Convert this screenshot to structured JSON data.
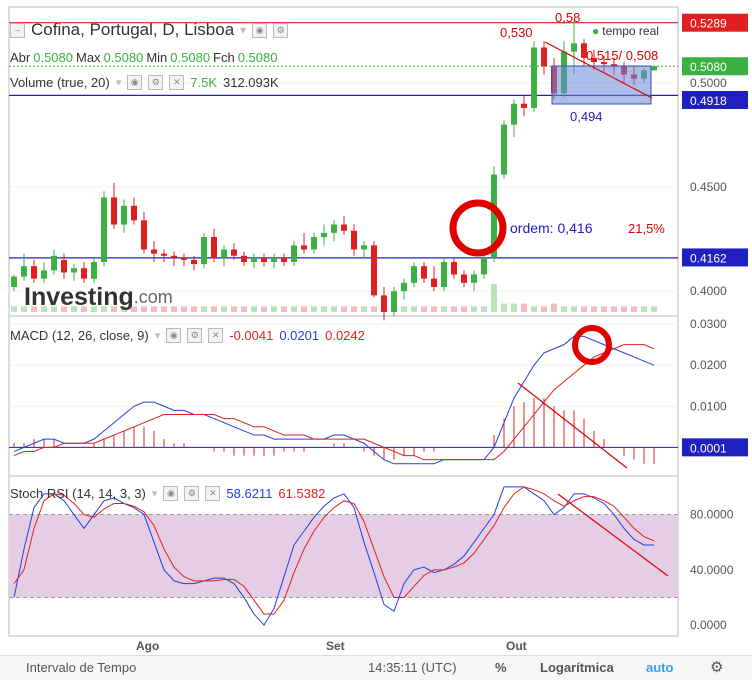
{
  "header": {
    "title": "Cofina, Portugal, D, Lisboa",
    "live_label": "tempo real",
    "ohlc": {
      "open_label": "Abr",
      "open": "0.5080",
      "high_label": "Max",
      "high": "0.5080",
      "low_label": "Min",
      "low": "0.5080",
      "close_label": "Fch",
      "close": "0.5080"
    },
    "volume": {
      "label": "Volume (true, 20)",
      "value1": "7.5K",
      "value2": "312.093K"
    }
  },
  "macd_header": {
    "label": "MACD (12, 26, close, 9)",
    "v1": "-0.0041",
    "v2": "0.0201",
    "v3": "0.0242"
  },
  "stoch_header": {
    "label": "Stoch RSI (14, 14, 3, 3)",
    "v1": "58.6211",
    "v2": "61.5382"
  },
  "logo": {
    "brand": "Investing",
    "suffix": ".com"
  },
  "bottom": {
    "interval": "Intervalo de Tempo",
    "time": "14:35:11 (UTC)",
    "percent": "%",
    "log": "Logarítmica",
    "auto": "auto"
  },
  "colors": {
    "up": "#3cb043",
    "down": "#e02020",
    "macd": "#2040e0",
    "signal": "#e02020",
    "stoch_band": "#e6cde6",
    "annot_blue": "#2020c0",
    "annot_red": "#e00000"
  },
  "annotations": {
    "hi1": "0,530",
    "hi2": "0,58",
    "pair": "0,515/ 0,508",
    "mid": "0,494",
    "ordem": "ordem: 0,416",
    "pct": "21,5%"
  },
  "chart_data": [
    {
      "type": "candlestick",
      "title": "Cofina, Portugal, D, Lisboa",
      "x_ticks": [
        "Ago",
        "Set",
        "Out"
      ],
      "y_ticks": [
        "0.4000",
        "0.4500",
        "0.5000"
      ],
      "ylim": [
        0.39,
        0.535
      ],
      "price_labels": [
        {
          "value": 0.5289,
          "label": "0.5289",
          "color": "#e02020"
        },
        {
          "value": 0.508,
          "label": "0.5080",
          "color": "#3cb043"
        },
        {
          "value": 0.4918,
          "label": "0.4918",
          "color": "#2020c0"
        },
        {
          "value": 0.4162,
          "label": "0.4162",
          "color": "#2020c0"
        }
      ],
      "hlines": [
        0.5289,
        0.508,
        0.494,
        0.416
      ],
      "candles": [
        [
          0.402,
          0.408,
          0.4,
          0.407
        ],
        [
          0.407,
          0.418,
          0.405,
          0.412
        ],
        [
          0.412,
          0.415,
          0.404,
          0.406
        ],
        [
          0.406,
          0.414,
          0.404,
          0.41
        ],
        [
          0.41,
          0.42,
          0.408,
          0.417
        ],
        [
          0.415,
          0.418,
          0.406,
          0.409
        ],
        [
          0.409,
          0.413,
          0.405,
          0.411
        ],
        [
          0.411,
          0.414,
          0.404,
          0.406
        ],
        [
          0.406,
          0.416,
          0.404,
          0.414
        ],
        [
          0.414,
          0.448,
          0.412,
          0.445
        ],
        [
          0.445,
          0.452,
          0.43,
          0.432
        ],
        [
          0.432,
          0.444,
          0.428,
          0.441
        ],
        [
          0.441,
          0.445,
          0.432,
          0.434
        ],
        [
          0.434,
          0.438,
          0.418,
          0.42
        ],
        [
          0.42,
          0.424,
          0.414,
          0.418
        ],
        [
          0.418,
          0.42,
          0.414,
          0.417
        ],
        [
          0.417,
          0.419,
          0.412,
          0.416
        ],
        [
          0.416,
          0.418,
          0.412,
          0.415
        ],
        [
          0.415,
          0.417,
          0.41,
          0.413
        ],
        [
          0.413,
          0.428,
          0.411,
          0.426
        ],
        [
          0.426,
          0.43,
          0.414,
          0.416
        ],
        [
          0.416,
          0.422,
          0.412,
          0.42
        ],
        [
          0.42,
          0.423,
          0.415,
          0.417
        ],
        [
          0.417,
          0.419,
          0.412,
          0.414
        ],
        [
          0.414,
          0.418,
          0.411,
          0.416
        ],
        [
          0.416,
          0.418,
          0.412,
          0.414
        ],
        [
          0.414,
          0.418,
          0.411,
          0.416
        ],
        [
          0.416,
          0.418,
          0.412,
          0.414
        ],
        [
          0.414,
          0.424,
          0.412,
          0.422
        ],
        [
          0.422,
          0.428,
          0.418,
          0.42
        ],
        [
          0.42,
          0.428,
          0.418,
          0.426
        ],
        [
          0.426,
          0.432,
          0.422,
          0.428
        ],
        [
          0.428,
          0.434,
          0.424,
          0.432
        ],
        [
          0.432,
          0.436,
          0.427,
          0.429
        ],
        [
          0.429,
          0.432,
          0.417,
          0.42
        ],
        [
          0.42,
          0.424,
          0.416,
          0.422
        ],
        [
          0.422,
          0.424,
          0.397,
          0.398
        ],
        [
          0.398,
          0.402,
          0.386,
          0.39
        ],
        [
          0.39,
          0.402,
          0.388,
          0.4
        ],
        [
          0.4,
          0.406,
          0.396,
          0.404
        ],
        [
          0.404,
          0.414,
          0.402,
          0.412
        ],
        [
          0.412,
          0.414,
          0.404,
          0.406
        ],
        [
          0.406,
          0.412,
          0.4,
          0.402
        ],
        [
          0.402,
          0.416,
          0.4,
          0.414
        ],
        [
          0.414,
          0.416,
          0.406,
          0.408
        ],
        [
          0.408,
          0.41,
          0.402,
          0.404
        ],
        [
          0.404,
          0.41,
          0.4,
          0.408
        ],
        [
          0.408,
          0.418,
          0.406,
          0.416
        ],
        [
          0.416,
          0.46,
          0.414,
          0.456
        ],
        [
          0.456,
          0.482,
          0.454,
          0.48
        ],
        [
          0.48,
          0.492,
          0.474,
          0.49
        ],
        [
          0.49,
          0.494,
          0.484,
          0.488
        ],
        [
          0.488,
          0.52,
          0.486,
          0.517
        ],
        [
          0.517,
          0.52,
          0.504,
          0.508
        ],
        [
          0.508,
          0.512,
          0.492,
          0.495
        ],
        [
          0.495,
          0.52,
          0.493,
          0.515
        ],
        [
          0.515,
          0.53,
          0.504,
          0.519
        ],
        [
          0.519,
          0.521,
          0.508,
          0.512
        ],
        [
          0.512,
          0.516,
          0.506,
          0.51
        ],
        [
          0.51,
          0.513,
          0.505,
          0.509
        ],
        [
          0.509,
          0.512,
          0.504,
          0.508
        ],
        [
          0.508,
          0.51,
          0.5,
          0.504
        ],
        [
          0.504,
          0.508,
          0.499,
          0.502
        ],
        [
          0.502,
          0.507,
          0.5,
          0.506
        ],
        [
          0.506,
          0.508,
          0.506,
          0.508
        ]
      ],
      "volume_bars": [
        0.2,
        0.2,
        0.2,
        0.2,
        0.2,
        0.2,
        0.2,
        0.2,
        0.2,
        0.2,
        0.2,
        0.2,
        0.2,
        0.2,
        0.2,
        0.2,
        0.2,
        0.2,
        0.2,
        0.2,
        0.2,
        0.2,
        0.2,
        0.2,
        0.2,
        0.2,
        0.2,
        0.2,
        0.2,
        0.2,
        0.2,
        0.2,
        0.2,
        0.2,
        0.2,
        0.2,
        0.2,
        0.2,
        0.2,
        0.2,
        0.2,
        0.2,
        0.2,
        0.2,
        0.2,
        0.2,
        0.2,
        0.2,
        1.0,
        0.3,
        0.3,
        0.3,
        0.2,
        0.2,
        0.3,
        0.2,
        0.2,
        0.2,
        0.2,
        0.2,
        0.2,
        0.2,
        0.2,
        0.2,
        0.2
      ]
    },
    {
      "type": "line",
      "title": "MACD (12, 26, close, 9)",
      "y_ticks": [
        "0.0000",
        "0.0100",
        "0.0200",
        "0.0300"
      ],
      "ylim": [
        -0.006,
        0.031
      ],
      "price_label": "0.0001",
      "series": [
        {
          "name": "MACD",
          "values": [
            -0.001,
            0.0,
            0.001,
            0.002,
            0.002,
            0.001,
            0.001,
            0.001,
            0.002,
            0.004,
            0.006,
            0.008,
            0.01,
            0.011,
            0.011,
            0.01,
            0.009,
            0.009,
            0.008,
            0.008,
            0.007,
            0.006,
            0.005,
            0.004,
            0.003,
            0.003,
            0.002,
            0.002,
            0.002,
            0.002,
            0.002,
            0.002,
            0.003,
            0.003,
            0.002,
            0.001,
            -0.001,
            -0.003,
            -0.004,
            -0.004,
            -0.004,
            -0.004,
            -0.004,
            -0.003,
            -0.003,
            -0.003,
            -0.003,
            -0.003,
            0.0,
            0.006,
            0.012,
            0.016,
            0.02,
            0.023,
            0.024,
            0.025,
            0.027,
            0.027,
            0.026,
            0.025,
            0.024,
            0.023,
            0.022,
            0.021,
            0.02
          ]
        },
        {
          "name": "Signal",
          "values": [
            -0.002,
            -0.001,
            -0.001,
            0.0,
            0.0,
            0.001,
            0.001,
            0.001,
            0.001,
            0.002,
            0.003,
            0.004,
            0.005,
            0.006,
            0.007,
            0.008,
            0.008,
            0.008,
            0.008,
            0.008,
            0.008,
            0.007,
            0.007,
            0.006,
            0.005,
            0.005,
            0.004,
            0.003,
            0.003,
            0.003,
            0.002,
            0.002,
            0.002,
            0.002,
            0.002,
            0.002,
            0.001,
            0.0,
            -0.001,
            -0.002,
            -0.002,
            -0.003,
            -0.003,
            -0.003,
            -0.003,
            -0.003,
            -0.003,
            -0.003,
            -0.003,
            -0.001,
            0.002,
            0.005,
            0.008,
            0.011,
            0.014,
            0.016,
            0.018,
            0.02,
            0.022,
            0.023,
            0.024,
            0.025,
            0.025,
            0.025,
            0.024
          ]
        }
      ],
      "histogram": [
        0.001,
        0.001,
        0.002,
        0.002,
        0.002,
        0.0,
        0.0,
        0.0,
        0.001,
        0.002,
        0.003,
        0.004,
        0.005,
        0.005,
        0.004,
        0.002,
        0.001,
        0.001,
        0.0,
        0.0,
        -0.001,
        -0.001,
        -0.002,
        -0.002,
        -0.002,
        -0.002,
        -0.002,
        -0.001,
        -0.001,
        -0.001,
        0.0,
        0.0,
        0.001,
        0.001,
        0.0,
        -0.001,
        -0.002,
        -0.003,
        -0.003,
        -0.002,
        -0.002,
        -0.001,
        -0.001,
        0.0,
        0.0,
        0.0,
        0.0,
        0.0,
        0.003,
        0.007,
        0.01,
        0.011,
        0.012,
        0.012,
        0.01,
        0.009,
        0.009,
        0.007,
        0.004,
        0.002,
        0.0,
        -0.002,
        -0.003,
        -0.004,
        -0.004
      ]
    },
    {
      "type": "line",
      "title": "Stoch RSI (14, 14, 3, 3)",
      "y_ticks": [
        "0.0000",
        "40.0000",
        "80.0000"
      ],
      "ylim": [
        -5,
        105
      ],
      "band": [
        20,
        80
      ],
      "series": [
        {
          "name": "K",
          "values": [
            20,
            55,
            85,
            95,
            95,
            90,
            80,
            70,
            80,
            90,
            92,
            88,
            85,
            80,
            60,
            40,
            32,
            30,
            30,
            32,
            34,
            34,
            30,
            20,
            8,
            0,
            12,
            35,
            58,
            68,
            78,
            86,
            92,
            95,
            85,
            60,
            38,
            15,
            10,
            30,
            40,
            42,
            38,
            40,
            44,
            50,
            60,
            70,
            80,
            100,
            100,
            100,
            95,
            90,
            80,
            85,
            95,
            95,
            92,
            88,
            80,
            70,
            62,
            58,
            58
          ]
        },
        {
          "name": "D",
          "values": [
            30,
            40,
            70,
            90,
            95,
            94,
            88,
            80,
            78,
            84,
            88,
            88,
            86,
            82,
            72,
            55,
            42,
            35,
            32,
            32,
            32,
            33,
            33,
            28,
            18,
            8,
            8,
            18,
            38,
            55,
            68,
            78,
            85,
            90,
            88,
            75,
            55,
            35,
            20,
            20,
            28,
            36,
            40,
            40,
            42,
            45,
            52,
            62,
            72,
            85,
            95,
            100,
            98,
            95,
            90,
            86,
            90,
            93,
            93,
            90,
            86,
            78,
            70,
            64,
            61
          ]
        }
      ]
    }
  ]
}
